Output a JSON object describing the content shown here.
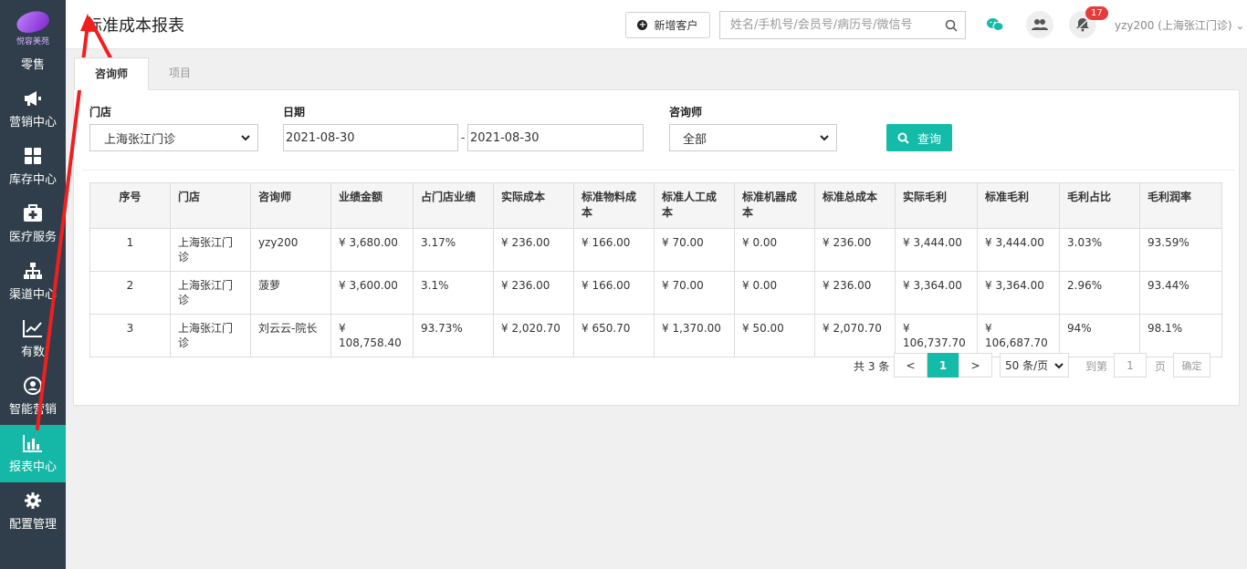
{
  "sidebar": {
    "logo_text": "悦容美苑",
    "items": [
      {
        "label": "零售",
        "icon": "retail-icon"
      },
      {
        "label": "营销中心",
        "icon": "megaphone-icon"
      },
      {
        "label": "库存中心",
        "icon": "grid-icon"
      },
      {
        "label": "医疗服务",
        "icon": "medical-kit-icon"
      },
      {
        "label": "渠道中心",
        "icon": "org-chart-icon"
      },
      {
        "label": "有数",
        "icon": "line-chart-icon"
      },
      {
        "label": "智能营销",
        "icon": "smart-marketing-icon"
      },
      {
        "label": "报表中心",
        "icon": "bar-chart-icon",
        "active": true
      },
      {
        "label": "配置管理",
        "icon": "gear-icon"
      }
    ]
  },
  "header": {
    "title": "标准成本报表",
    "new_client_label": "新增客户",
    "search_placeholder": "姓名/手机号/会员号/病历号/微信号",
    "notification_count": "17",
    "user_label": "yzy200 (上海张江门诊)"
  },
  "tabs": [
    {
      "label": "咨询师",
      "active": true
    },
    {
      "label": "项目",
      "active": false
    }
  ],
  "filters": {
    "store_label": "门店",
    "store_value": "上海张江门诊",
    "date_label": "日期",
    "date_from": "2021-08-30",
    "date_sep": "-",
    "date_to": "2021-08-30",
    "consultant_label": "咨询师",
    "consultant_value": "全部",
    "query_label": "查询"
  },
  "table": {
    "headers": [
      "序号",
      "门店",
      "咨询师",
      "业绩金额",
      "占门店业绩",
      "实际成本",
      "标准物料成本",
      "标准人工成本",
      "标准机器成本",
      "标准总成本",
      "实际毛利",
      "标准毛利",
      "毛利占比",
      "毛利润率"
    ],
    "rows": [
      [
        "1",
        "上海张江门诊",
        "yzy200",
        "¥ 3,680.00",
        "3.17%",
        "¥ 236.00",
        "¥ 166.00",
        "¥ 70.00",
        "¥ 0.00",
        "¥ 236.00",
        "¥ 3,444.00",
        "¥ 3,444.00",
        "3.03%",
        "93.59%"
      ],
      [
        "2",
        "上海张江门诊",
        "菠萝",
        "¥ 3,600.00",
        "3.1%",
        "¥ 236.00",
        "¥ 166.00",
        "¥ 70.00",
        "¥ 0.00",
        "¥ 236.00",
        "¥ 3,364.00",
        "¥ 3,364.00",
        "2.96%",
        "93.44%"
      ],
      [
        "3",
        "上海张江门诊",
        "刘云云-院长",
        "¥ 108,758.40",
        "93.73%",
        "¥ 2,020.70",
        "¥ 650.70",
        "¥ 1,370.00",
        "¥ 50.00",
        "¥ 2,070.70",
        "¥ 106,737.70",
        "¥ 106,687.70",
        "94%",
        "98.1%"
      ]
    ]
  },
  "pagination": {
    "total_label": "共 3 条",
    "prev": "<",
    "current": "1",
    "next": ">",
    "page_size": "50 条/页",
    "goto_label": "到第",
    "goto_value": "1",
    "page_unit": "页",
    "confirm_label": "确定"
  },
  "colors": {
    "sidebar_bg": "#2f3e4a",
    "accent": "#15bba9",
    "badge": "#e63b3b",
    "annotation_arrow": "#f01f1f"
  }
}
